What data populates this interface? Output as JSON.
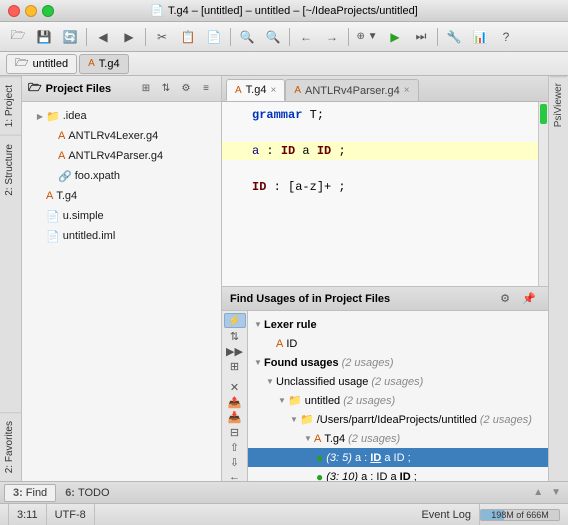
{
  "titleBar": {
    "text": "T.g4 – [untitled] – untitled – [~/IdeaProjects/untitled]",
    "fileIcon": "📄"
  },
  "toolbar": {
    "buttons": [
      "🗁",
      "💾",
      "🔄",
      "◀",
      "▶",
      "✂",
      "📋",
      "📄",
      "🔍",
      "🔍",
      "←",
      "→",
      "⊕",
      "▼",
      "▶",
      "⏭",
      "🔧",
      "📊",
      "?"
    ]
  },
  "breadcrumb": {
    "tabs": [
      {
        "label": "untitled",
        "icon": "🗁"
      },
      {
        "label": "T.g4",
        "icon": "📄"
      }
    ]
  },
  "projectPanel": {
    "title": "Project Files",
    "items": [
      {
        "label": ".idea",
        "indent": 1,
        "type": "folder",
        "expanded": true
      },
      {
        "label": "ANTLRv4Lexer.g4",
        "indent": 2,
        "type": "antlr"
      },
      {
        "label": "ANTLRv4Parser.g4",
        "indent": 2,
        "type": "antlr"
      },
      {
        "label": "foo.xpath",
        "indent": 2,
        "type": "xml"
      },
      {
        "label": "T.g4",
        "indent": 1,
        "type": "antlr"
      },
      {
        "label": "u.simple",
        "indent": 1,
        "type": "file"
      },
      {
        "label": "untitled.iml",
        "indent": 1,
        "type": "file"
      }
    ]
  },
  "editorTabs": [
    {
      "label": "T.g4",
      "active": true,
      "closeable": true
    },
    {
      "label": "ANTLRv4Parser.g4",
      "active": false,
      "closeable": true
    }
  ],
  "editorCode": [
    {
      "line": "",
      "text": "grammar T;",
      "highlighted": false
    },
    {
      "line": "",
      "text": "",
      "highlighted": false
    },
    {
      "line": "",
      "text": "a : ID a ID ;",
      "highlighted": true
    },
    {
      "line": "",
      "text": "",
      "highlighted": false
    },
    {
      "line": "",
      "text": "ID : [a-z]+ ;",
      "highlighted": false
    }
  ],
  "findUsages": {
    "title": "Find Usages of",
    "inText": "in Project Files",
    "tree": [
      {
        "label": "Lexer rule",
        "indent": 0,
        "type": "section",
        "arrow": "▼"
      },
      {
        "label": "ID",
        "indent": 1,
        "type": "rule"
      },
      {
        "label": "Found usages",
        "indent": 0,
        "type": "section",
        "arrow": "▼",
        "count": "(2 usages)"
      },
      {
        "label": "Unclassified usage",
        "indent": 1,
        "type": "group",
        "arrow": "▼",
        "count": "(2 usages)"
      },
      {
        "label": "untitled",
        "indent": 2,
        "type": "folder",
        "arrow": "▼",
        "count": "(2 usages)"
      },
      {
        "label": "/Users/parrt/IdeaProjects/untitled",
        "indent": 3,
        "type": "folder",
        "arrow": "▼",
        "count": "(2 usages)"
      },
      {
        "label": "T.g4",
        "indent": 4,
        "type": "antlr",
        "arrow": "▼",
        "count": "(2 usages)"
      },
      {
        "label": "(3: 5) a : ID a ID ;",
        "indent": 5,
        "type": "usage",
        "selected": true
      },
      {
        "label": "(3: 10) a : ID a ID ;",
        "indent": 5,
        "type": "usage",
        "selected": false
      }
    ]
  },
  "bottomTabs": [
    {
      "num": "3",
      "label": "Find",
      "active": true
    },
    {
      "num": "6",
      "label": "TODO",
      "active": false
    }
  ],
  "statusBar": {
    "position": "3:11",
    "encoding": "UTF-8",
    "memory": "198M of 666M",
    "memPercent": 30
  },
  "rightSidebar": {
    "label": "PsiViewer"
  }
}
